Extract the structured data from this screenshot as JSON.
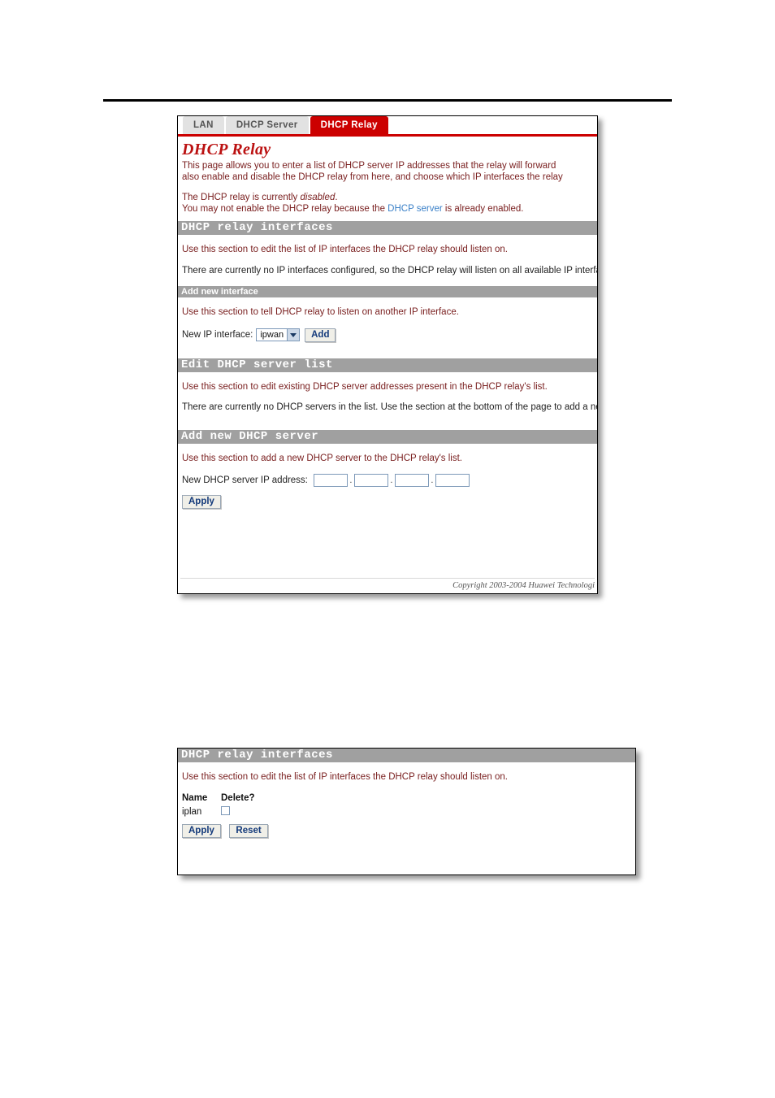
{
  "main_panel": {
    "tabs": [
      {
        "label": "LAN",
        "active": false
      },
      {
        "label": "DHCP Server",
        "active": false
      },
      {
        "label": "DHCP Relay",
        "active": true
      }
    ],
    "title": "DHCP Relay",
    "intro_line1": "This page allows you to enter a list of DHCP server IP addresses that the relay will forward",
    "intro_line2": "also enable and disable the DHCP relay from here, and choose which IP interfaces the relay",
    "status_line_prefix": "The DHCP relay is currently ",
    "status_value": "disabled",
    "status_line_suffix": ".",
    "warn_prefix": "You may not enable the DHCP relay because the ",
    "warn_link": "DHCP server",
    "warn_suffix": " is already enabled.",
    "sections": {
      "relay_interfaces": {
        "header": "DHCP relay interfaces",
        "desc": "Use this section to edit the list of IP interfaces the DHCP relay should listen on.",
        "note": "There are currently no IP interfaces configured, so the DHCP relay will listen on all available IP interfaces."
      },
      "add_new_interface": {
        "header": "Add new interface",
        "desc": "Use this section to tell DHCP relay to listen on another IP interface.",
        "field_label": "New IP interface:",
        "select_value": "ipwan",
        "select_options": [
          "ipwan"
        ],
        "add_button": "Add"
      },
      "edit_server_list": {
        "header": "Edit DHCP server list",
        "desc": "Use this section to edit existing DHCP server addresses present in the DHCP relay's list.",
        "note": "There are currently no DHCP servers in the list. Use the section at the bottom of the page to add a new D"
      },
      "add_new_server": {
        "header": "Add new DHCP server",
        "desc": "Use this section to add a new DHCP server to the DHCP relay's list.",
        "field_label": "New DHCP server IP address:",
        "octets": [
          "",
          "",
          "",
          ""
        ],
        "separator": ".",
        "apply_button": "Apply"
      }
    },
    "copyright": "Copyright 2003-2004 Huawei Technologi"
  },
  "interfaces_panel": {
    "header": "DHCP relay interfaces",
    "desc": "Use this section to edit the list of IP interfaces the DHCP relay should listen on.",
    "columns": [
      "Name",
      "Delete?"
    ],
    "rows": [
      {
        "name": "iplan",
        "delete_checked": false
      }
    ],
    "apply_button": "Apply",
    "reset_button": "Reset"
  },
  "colors": {
    "accent_red": "#cc0000",
    "title_red": "#bb1111",
    "body_red": "#7a2020",
    "section_gray": "#a0a0a0",
    "link_blue": "#3a80c8",
    "button_text": "#143a7b"
  }
}
